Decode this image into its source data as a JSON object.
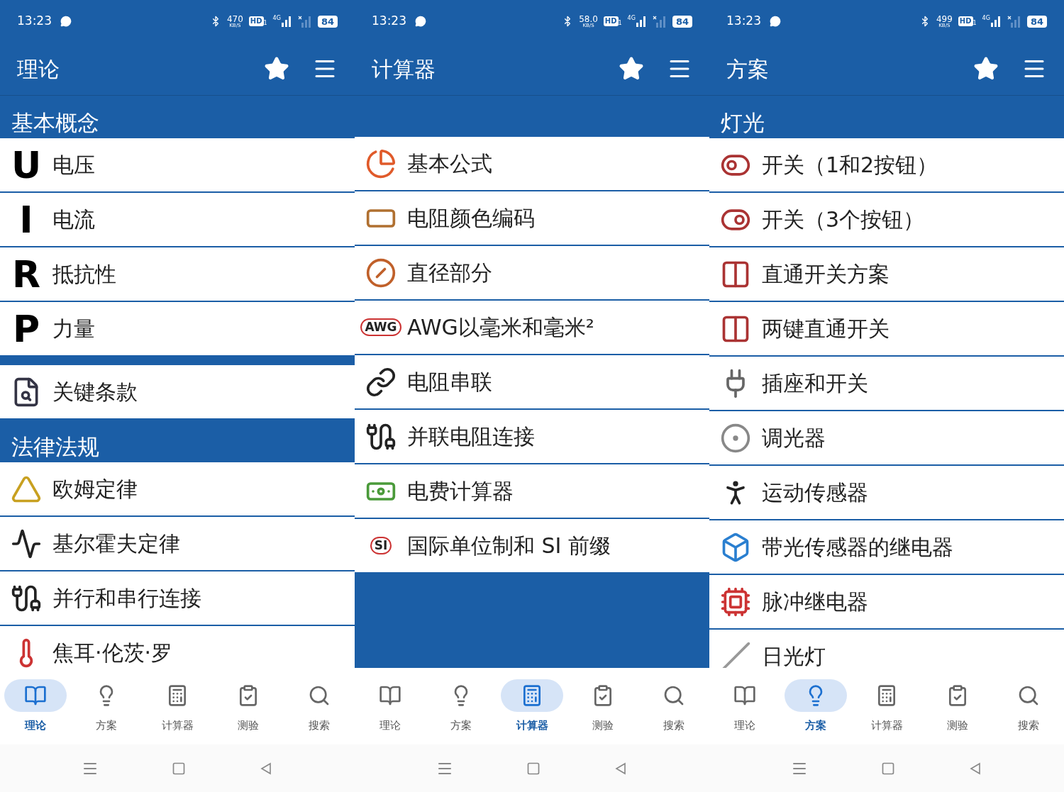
{
  "phones": [
    {
      "status_bar": {
        "time": "13:23",
        "speed": "470",
        "speed_unit": "KB/S",
        "hd": "HD",
        "sim": "1",
        "network": "4G",
        "battery": "84"
      },
      "app_bar": {
        "title": "理论"
      },
      "rows": [
        {
          "kind": "header",
          "label": "基本概念"
        },
        {
          "kind": "letter",
          "letter": "U",
          "label": "电压"
        },
        {
          "kind": "letter",
          "letter": "I",
          "label": "电流"
        },
        {
          "kind": "letter",
          "letter": "R",
          "label": "抵抗性"
        },
        {
          "kind": "letter",
          "letter": "P",
          "label": "力量"
        },
        {
          "kind": "gap"
        },
        {
          "kind": "image",
          "label": "关键条款"
        },
        {
          "kind": "header",
          "label": "法律法规"
        },
        {
          "kind": "image",
          "label": "欧姆定律"
        },
        {
          "kind": "image",
          "label": "基尔霍夫定律"
        },
        {
          "kind": "image",
          "label": "并行和串行连接"
        },
        {
          "kind": "image",
          "label": "焦耳·伦茨·罗"
        }
      ],
      "nav": [
        {
          "label": "理论",
          "selected": true
        },
        {
          "label": "方案",
          "selected": false
        },
        {
          "label": "计算器",
          "selected": false
        },
        {
          "label": "测验",
          "selected": false
        },
        {
          "label": "搜索",
          "selected": false
        }
      ]
    },
    {
      "status_bar": {
        "time": "13:23",
        "speed": "58.0",
        "speed_unit": "KB/S",
        "hd": "HD",
        "sim": "1",
        "network": "4G",
        "battery": "84"
      },
      "app_bar": {
        "title": "计算器"
      },
      "rows": [
        {
          "kind": "blank_header"
        },
        {
          "kind": "image",
          "label": "基本公式"
        },
        {
          "kind": "image",
          "label": "电阻颜色编码"
        },
        {
          "kind": "image",
          "label": "直径部分"
        },
        {
          "kind": "badge",
          "badge": "AWG",
          "label": "AWG以毫米和毫米²"
        },
        {
          "kind": "image",
          "label": "电阻串联"
        },
        {
          "kind": "image",
          "label": "并联电阻连接"
        },
        {
          "kind": "image",
          "label": "电费计算器"
        },
        {
          "kind": "badge",
          "badge": "SI",
          "label": "国际单位制和 SI 前缀"
        }
      ],
      "nav": [
        {
          "label": "理论",
          "selected": false
        },
        {
          "label": "方案",
          "selected": false
        },
        {
          "label": "计算器",
          "selected": true
        },
        {
          "label": "测验",
          "selected": false
        },
        {
          "label": "搜索",
          "selected": false
        }
      ]
    },
    {
      "status_bar": {
        "time": "13:23",
        "speed": "499",
        "speed_unit": "KB/S",
        "hd": "HD",
        "sim": "1",
        "network": "4G",
        "battery": "84"
      },
      "app_bar": {
        "title": "方案"
      },
      "rows": [
        {
          "kind": "header",
          "label": "灯光"
        },
        {
          "kind": "image",
          "label": "开关（1和2按钮）"
        },
        {
          "kind": "image",
          "label": "开关（3个按钮）"
        },
        {
          "kind": "image",
          "label": "直通开关方案"
        },
        {
          "kind": "image",
          "label": "两键直通开关"
        },
        {
          "kind": "image",
          "label": "插座和开关"
        },
        {
          "kind": "image",
          "label": "调光器"
        },
        {
          "kind": "image",
          "label": "运动传感器"
        },
        {
          "kind": "image",
          "label": "带光传感器的继电器"
        },
        {
          "kind": "image",
          "label": "脉冲继电器"
        },
        {
          "kind": "image",
          "label": "日光灯"
        }
      ],
      "nav": [
        {
          "label": "理论",
          "selected": false
        },
        {
          "label": "方案",
          "selected": true
        },
        {
          "label": "计算器",
          "selected": false
        },
        {
          "label": "测验",
          "selected": false
        },
        {
          "label": "搜索",
          "selected": false
        }
      ]
    }
  ]
}
